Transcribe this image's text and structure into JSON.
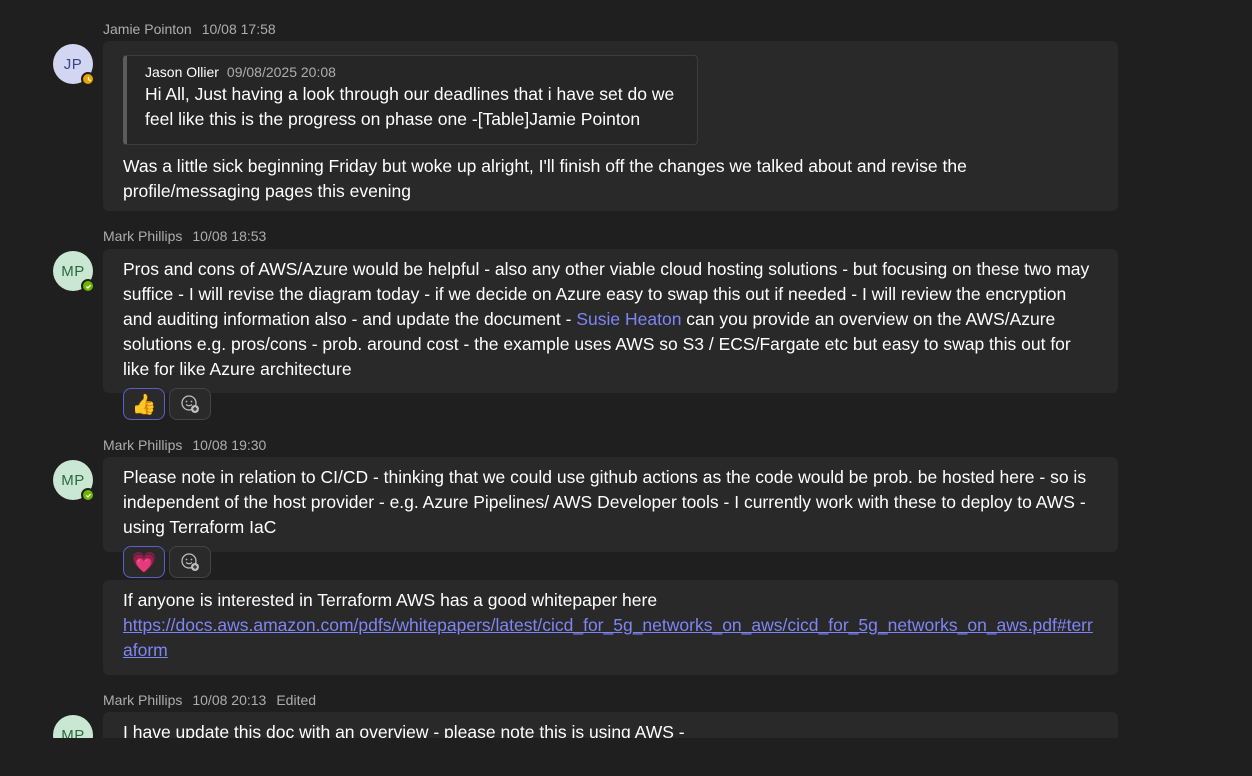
{
  "messages": [
    {
      "author": "Jamie Pointon",
      "time": "10/08 17:58",
      "initials": "JP",
      "presence": "away",
      "quote": {
        "author": "Jason Ollier",
        "time": "09/08/2025 20:08",
        "text": "Hi All, Just having a look through our deadlines that i have set do we feel like this is the progress on phase one -[Table]Jamie Pointon do..."
      },
      "text": "Was a little sick beginning Friday but woke up alright, I'll finish off the changes we talked about and revise the profile/messaging pages this evening"
    },
    {
      "author": "Mark Phillips",
      "time": "10/08 18:53",
      "initials": "MP",
      "presence": "online",
      "text_before": "Pros and cons of AWS/Azure would be helpful - also any other viable cloud hosting solutions - but focusing on these two may suffice -  I will revise the diagram today - if we decide on Azure easy to swap this out if needed - I will review the encryption and auditing information also - and update the document - ",
      "mention": "Susie Heaton",
      "text_after": " can you provide an overview on the AWS/Azure solutions e.g. pros/cons - prob. around cost - the example uses AWS so S3 / ECS/Fargate etc but easy to swap this out for like for like Azure architecture",
      "reaction": "👍",
      "reaction_icon": "thumbs-up-icon"
    },
    {
      "author": "Mark Phillips",
      "time": "10/08 19:30",
      "initials": "MP",
      "presence": "online",
      "text": "Please note in relation to CI/CD - thinking that we could use github actions as the code would be prob. be hosted here - so is independent of the host provider - e.g. Azure Pipelines/ AWS Developer tools - I currently work with these to deploy to AWS - using Terraform IaC",
      "reaction": "💗",
      "reaction_icon": "heart-icon",
      "followup_text": "If anyone is interested in Terraform AWS has a good whitepaper here",
      "followup_link": "https://docs.aws.amazon.com/pdfs/whitepapers/latest/cicd_for_5g_networks_on_aws/cicd_for_5g_networks_on_aws.pdf#terraform"
    },
    {
      "author": "Mark Phillips",
      "time": "10/08 20:13",
      "edited": "Edited",
      "initials": "MP",
      "presence": "online",
      "text": "I have update this doc with an overview - please note this is using AWS -"
    }
  ],
  "colors": {
    "background": "#1f1f1f",
    "bubble": "#292929",
    "accent": "#7f85f5",
    "reaction_border": "#5b5fc7",
    "presence_away": "#eaa300",
    "presence_online": "#6bb700"
  }
}
